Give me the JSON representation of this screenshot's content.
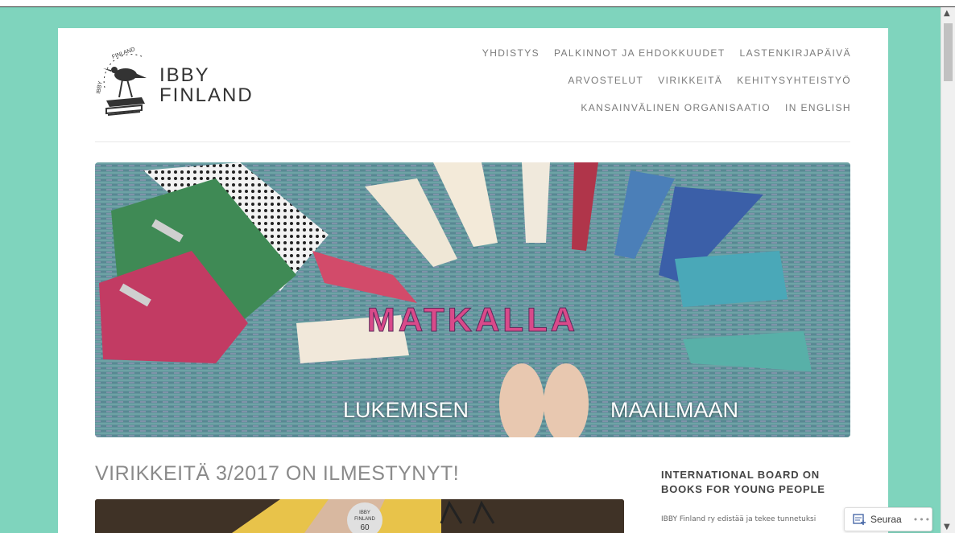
{
  "logo": {
    "line1": "IBBY",
    "line2": "FINLAND",
    "badge_text": "FINLAND",
    "badge_text_2": "IBBY"
  },
  "nav": {
    "row1": [
      "YHDISTYS",
      "PALKINNOT JA EHDOKKUUDET",
      "LASTENKIRJAPÄIVÄ"
    ],
    "row2": [
      "ARVOSTELUT",
      "VIRIKKEITÄ",
      "KEHITYSYHTEISTYÖ"
    ],
    "row3": [
      "KANSAINVÄLINEN ORGANISAATIO",
      "IN ENGLISH"
    ]
  },
  "hero": {
    "word": "MATKALLA",
    "caption_left": "LUKEMISEN",
    "caption_right": "MAAILMAAN"
  },
  "post": {
    "title": "VIRIKKEITÄ 3/2017 ON ILMESTYNYT!",
    "image_badge_line1": "IBBY",
    "image_badge_line2": "FINLAND",
    "image_badge_number": "60"
  },
  "sidebar": {
    "title": "INTERNATIONAL BOARD ON BOOKS FOR YOUNG PEOPLE",
    "text": "IBBY Finland ry edistää ja tekee tunnetuksi"
  },
  "follow": {
    "label": "Seuraa",
    "more": "•••"
  },
  "colors": {
    "background": "#7fd4bd",
    "nav_text": "#7a7a7a",
    "title_text": "#8a8a8a"
  }
}
